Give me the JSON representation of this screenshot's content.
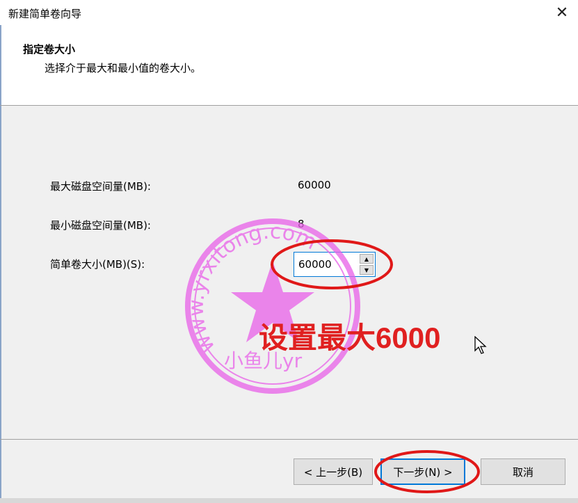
{
  "window": {
    "title": "新建简单卷向导",
    "close_glyph": "✕"
  },
  "header": {
    "title": "指定卷大小",
    "subtitle": "选择介于最大和最小值的卷大小。"
  },
  "form": {
    "max_label": "最大磁盘空间量(MB):",
    "max_value": "60000",
    "min_label": "最小磁盘空间量(MB):",
    "min_value": "8",
    "size_label": "简单卷大小(MB)(S):",
    "size_value": "60000"
  },
  "buttons": {
    "back": "< 上一步(B)",
    "next": "下一步(N) >",
    "cancel": "取消"
  },
  "annotation": {
    "text": "设置最大6000",
    "color": "#e02020"
  },
  "watermark": {
    "ring_text": "www.yrxitong.com",
    "inner_text": "小鱼儿yr",
    "color": "#e860e8"
  }
}
